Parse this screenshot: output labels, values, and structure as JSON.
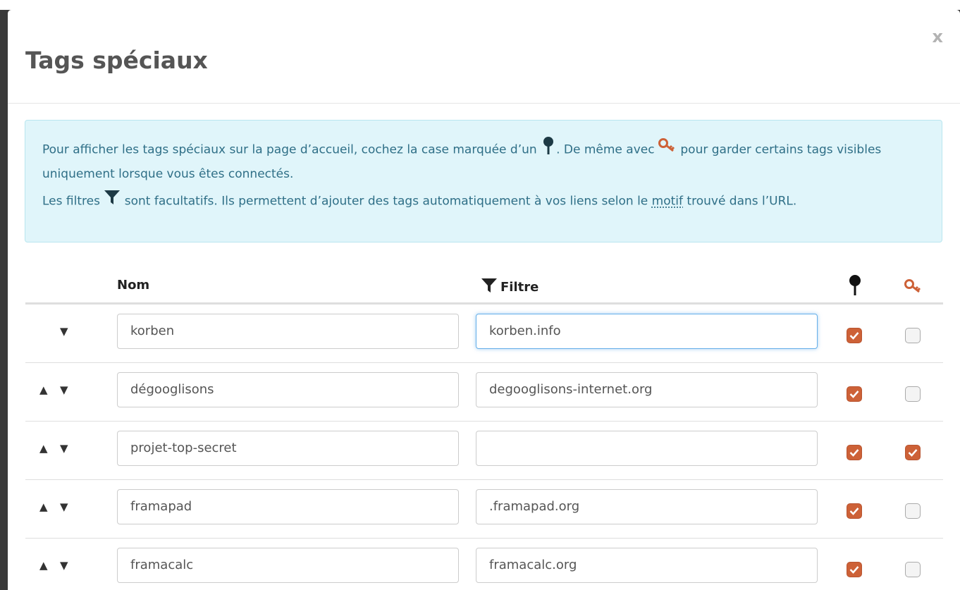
{
  "dialog": {
    "title": "Tags spéciaux",
    "close_label": "x"
  },
  "info": {
    "line1_a": "Pour afficher les tags spéciaux sur la page d’accueil, cochez la case marquée d’un",
    "line1_b": ". De même avec",
    "line1_c": "pour garder certains tags visibles uniquement lorsque vous êtes connectés.",
    "line2_a": "Les filtres",
    "line2_b": "sont facultatifs. Ils permettent d’ajouter des tags automatiquement à vos liens selon le",
    "line2_motif": "motif",
    "line2_c": "trouvé dans l’URL."
  },
  "table": {
    "headers": {
      "name": "Nom",
      "filter": "Filtre"
    },
    "rows": [
      {
        "up": "",
        "down": "▼",
        "name": "korben",
        "filter": "korben.info",
        "pin": true,
        "private": false
      },
      {
        "up": "▲",
        "down": "▼",
        "name": "dégooglisons",
        "filter": "degooglisons-internet.org",
        "pin": true,
        "private": false
      },
      {
        "up": "▲",
        "down": "▼",
        "name": "projet-top-secret",
        "filter": "",
        "pin": true,
        "private": true
      },
      {
        "up": "▲",
        "down": "▼",
        "name": "framapad",
        "filter": ".framapad.org",
        "pin": true,
        "private": false
      },
      {
        "up": "▲",
        "down": "▼",
        "name": "framacalc",
        "filter": "framacalc.org",
        "pin": true,
        "private": false
      }
    ]
  },
  "colors": {
    "accent": "#cd6137",
    "info_bg": "#e0f5fa",
    "info_text": "#2f6f87"
  },
  "icons": {
    "pin": "pin-icon",
    "key": "key-icon",
    "filter": "filter-icon"
  }
}
